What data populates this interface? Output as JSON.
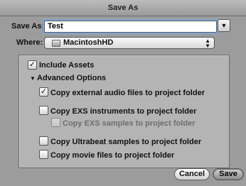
{
  "window": {
    "title": "Save As"
  },
  "save_as": {
    "label": "Save As:",
    "value": "Test",
    "expand_glyph": "▼"
  },
  "where": {
    "label": "Where:",
    "selected": "MacintoshHD",
    "stepper_up": "▲",
    "stepper_down": "▼"
  },
  "panel": {
    "include_assets": {
      "label": "Include Assets",
      "checked": true
    },
    "advanced": {
      "label": "Advanced Options",
      "disclosure": "▼",
      "expanded": true
    },
    "options": [
      {
        "label": "Copy external audio files to project folder",
        "checked": true,
        "enabled": true
      },
      {
        "label": "Copy EXS instruments to project folder",
        "checked": false,
        "enabled": true
      },
      {
        "label": "Copy EXS samples to project folder",
        "checked": false,
        "enabled": false
      },
      {
        "label": "Copy Ultrabeat samples to project folder",
        "checked": false,
        "enabled": true
      },
      {
        "label": "Copy movie files to project folder",
        "checked": false,
        "enabled": true
      }
    ]
  },
  "buttons": {
    "cancel": "Cancel",
    "save": "Save"
  },
  "check_glyph": "✓"
}
